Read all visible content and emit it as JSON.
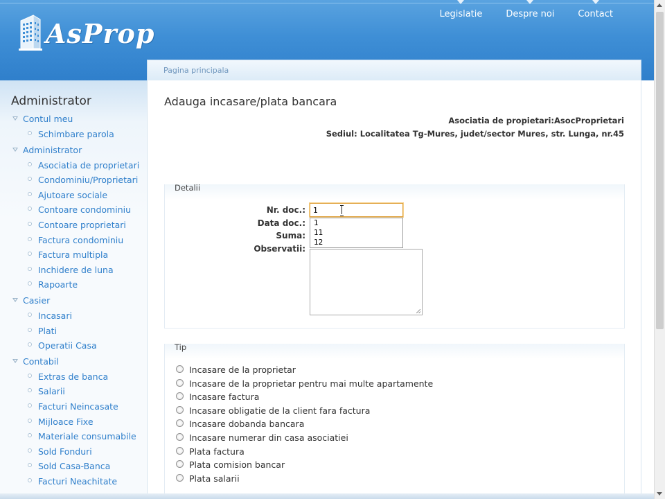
{
  "header": {
    "logo_text": "AsProp",
    "nav": [
      "Legislatie",
      "Despre noi",
      "Contact"
    ]
  },
  "breadcrumb": "Pagina principala",
  "sidebar": {
    "title": "Administrator",
    "groups": [
      {
        "label": "Contul meu",
        "items": [
          "Schimbare parola"
        ]
      },
      {
        "label": "Administrator",
        "items": [
          "Asociatia de proprietari",
          "Condominiu/Proprietari",
          "Ajutoare sociale",
          "Contoare condominiu",
          "Contoare proprietari",
          "Factura condominiu",
          "Factura multipla",
          "Inchidere de luna",
          "Rapoarte"
        ]
      },
      {
        "label": "Casier",
        "items": [
          "Incasari",
          "Plati",
          "Operatii Casa"
        ]
      },
      {
        "label": "Contabil",
        "items": [
          "Extras de banca",
          "Salarii",
          "Facturi Neincasate",
          "Mijloace Fixe",
          "Materiale consumabile",
          "Sold Fonduri",
          "Sold Casa-Banca",
          "Facturi Neachitate"
        ]
      }
    ]
  },
  "main": {
    "title": "Adauga incasare/plata bancara",
    "assoc_line": "Asociatia de propietari:AsocProprietari",
    "sediul_line": "Sediul: Localitatea Tg-Mures, judet/sector Mures, str. Lunga, nr.45",
    "detalii": {
      "legend": "Detalii",
      "labels": {
        "nr_doc": "Nr. doc.:",
        "data_doc": "Data doc.:",
        "suma": "Suma:",
        "observatii": "Observatii:"
      },
      "nr_doc_value": "1",
      "suggestions": [
        "1",
        "11",
        "12"
      ]
    },
    "tip": {
      "legend": "Tip",
      "options": [
        "Incasare de la proprietar",
        "Incasare de la proprietar pentru mai multe apartamente",
        "Incasare factura",
        "Incasare obligatie de la client fara factura",
        "Incasare dobanda bancara",
        "Incasare numerar din casa asociatiei",
        "Plata factura",
        "Plata comision bancar",
        "Plata salarii"
      ]
    }
  },
  "colors": {
    "header_blue": "#3f8fd6",
    "link_blue": "#2f7fcb",
    "focus_orange": "#e0a340"
  }
}
